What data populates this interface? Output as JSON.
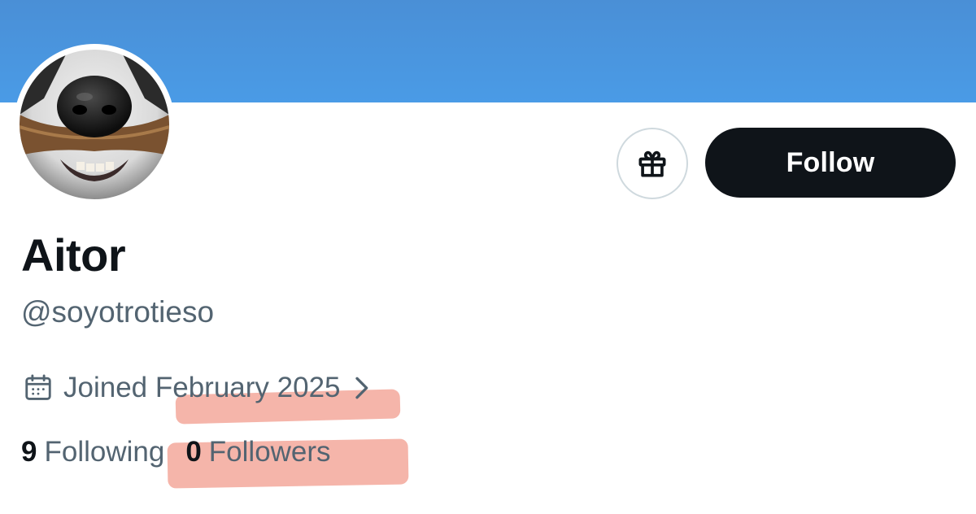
{
  "profile": {
    "display_name": "Aitor",
    "handle": "@soyotrotieso",
    "joined": "Joined February 2025",
    "following_count": "9",
    "following_label": "Following",
    "followers_count": "0",
    "followers_label": "Followers"
  },
  "actions": {
    "follow_label": "Follow",
    "gift_icon": "gift-icon"
  },
  "icons": {
    "calendar": "calendar-icon",
    "chevron": "chevron-right-icon"
  },
  "colors": {
    "banner": "#4a9be6",
    "follow_button_bg": "#0f1419",
    "follow_button_text": "#ffffff",
    "primary_text": "#0f1419",
    "secondary_text": "#536471",
    "highlight_marker": "#ec7864"
  }
}
